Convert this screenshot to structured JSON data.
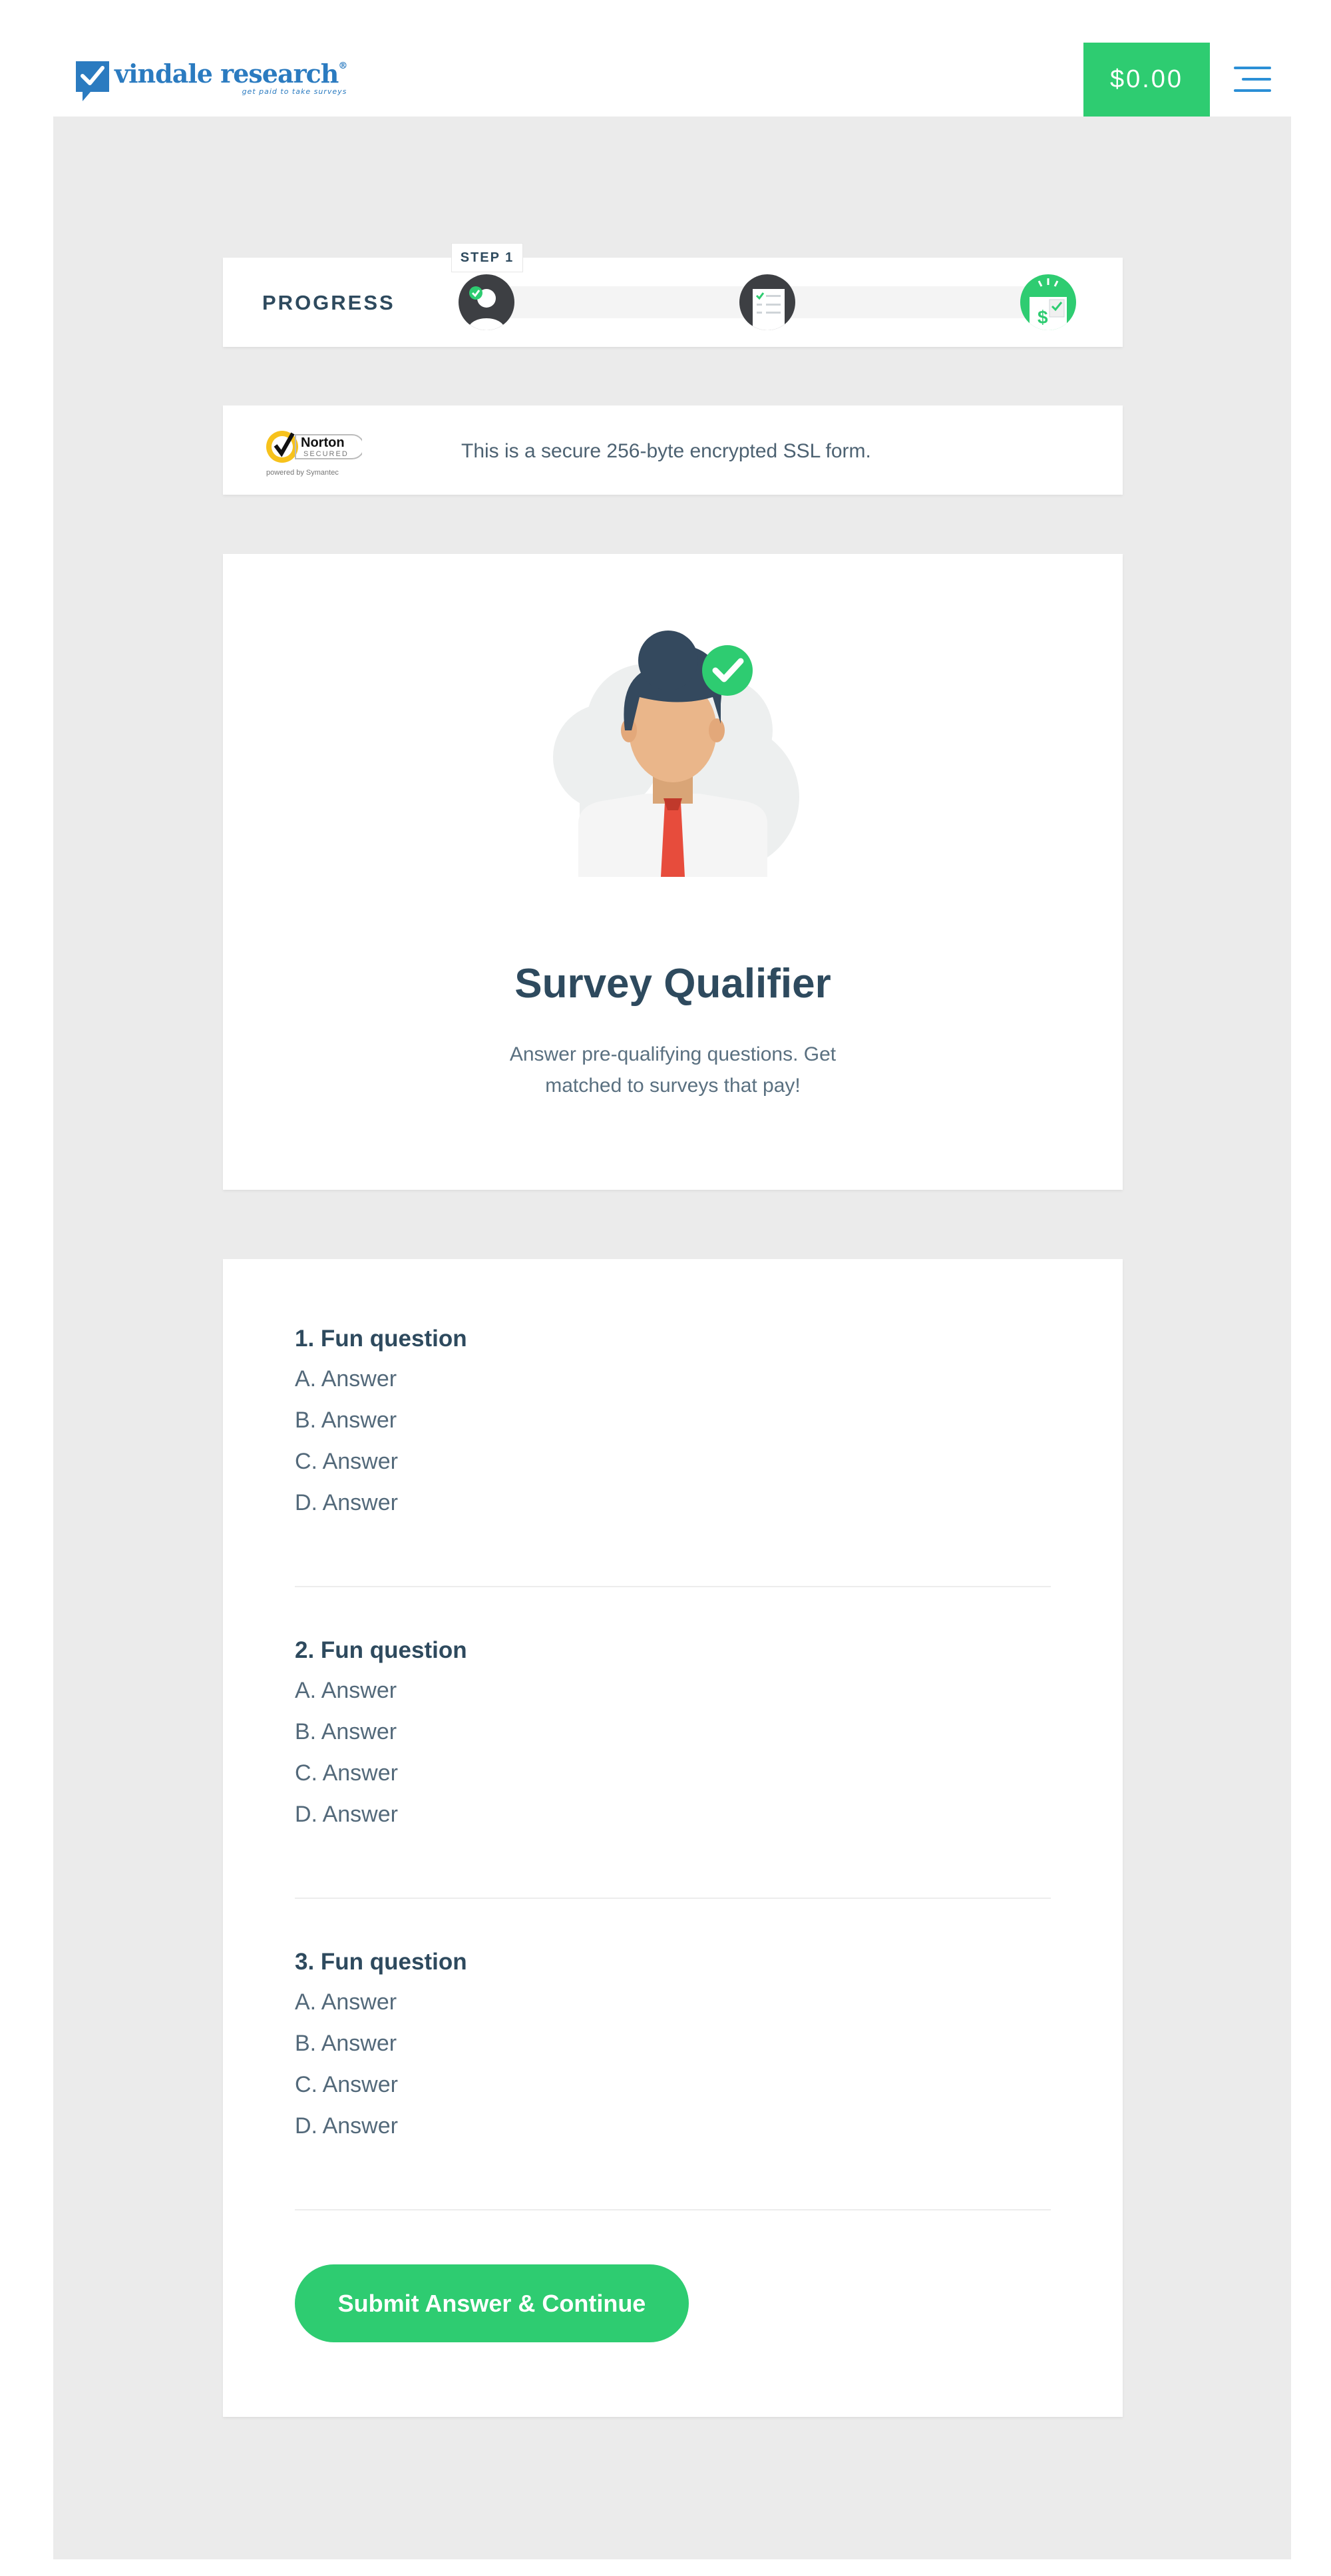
{
  "header": {
    "logo_text": "vindale research",
    "logo_tagline": "get paid to take surveys",
    "balance": "$0.00"
  },
  "progress": {
    "label": "PROGRESS",
    "step_tag": "STEP 1",
    "current_step": 1,
    "total_steps": 3
  },
  "secure": {
    "badge_title": "Norton",
    "badge_sub": "SECURED",
    "badge_powered": "powered by Symantec",
    "text": "This is a secure 256-byte encrypted SSL form."
  },
  "hero": {
    "title": "Survey Qualifier",
    "subtitle": "Answer pre-qualifying questions. Get matched to surveys that pay!"
  },
  "questions": [
    {
      "title": "1. Fun question",
      "answers": [
        "A. Answer",
        "B. Answer",
        "C. Answer",
        "D. Answer"
      ]
    },
    {
      "title": "2. Fun question",
      "answers": [
        "A. Answer",
        "B. Answer",
        "C. Answer",
        "D. Answer"
      ]
    },
    {
      "title": "3. Fun question",
      "answers": [
        "A. Answer",
        "B. Answer",
        "C. Answer",
        "D. Answer"
      ]
    }
  ],
  "submit_label": "Submit Answer & Continue",
  "colors": {
    "brand_blue": "#2b7bc0",
    "accent_green": "#2ecc71",
    "text_dark": "#2e4a5e",
    "page_grey": "#ebebeb"
  }
}
